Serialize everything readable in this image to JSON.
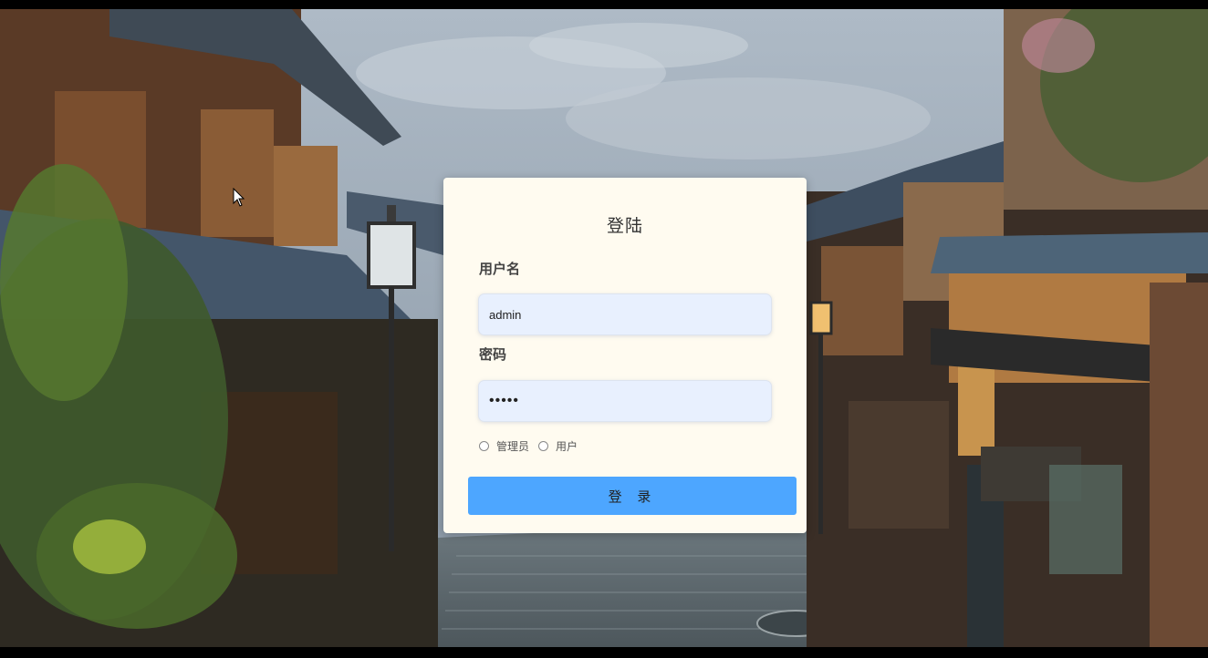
{
  "login": {
    "title": "登陆",
    "username_label": "用户名",
    "username_value": "admin",
    "password_label": "密码",
    "password_value": "•••••",
    "roles": [
      "管理员",
      "用户"
    ],
    "selected_role": null,
    "submit_label": "登 录"
  },
  "colors": {
    "card_background": "#fffbf0",
    "input_background": "#e8f0fe",
    "submit_button": "#4da6ff"
  }
}
